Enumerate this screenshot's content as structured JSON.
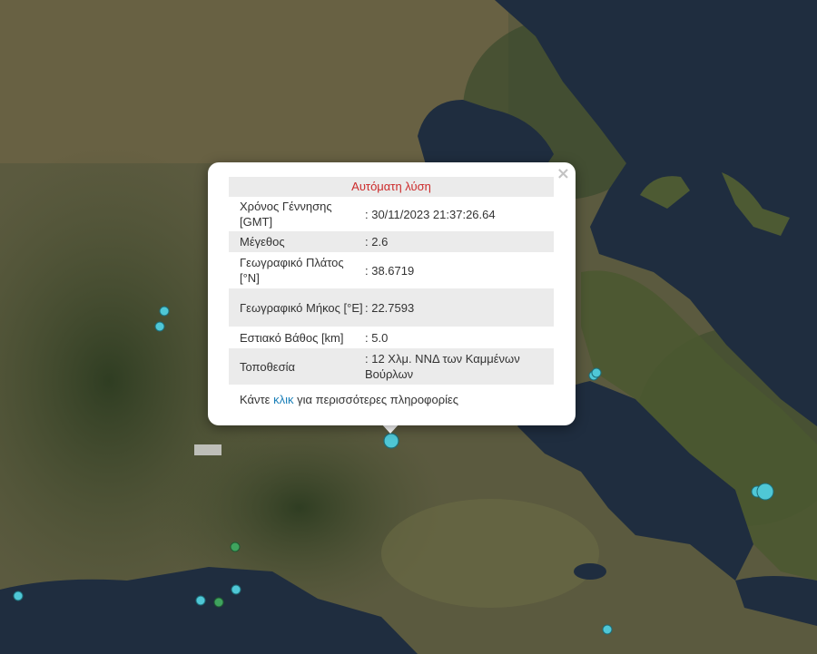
{
  "popup": {
    "title": "Αυτόματη λύση",
    "close": "×",
    "rows": [
      {
        "label": "Χρόνος Γέννησης [GMT]",
        "value": ": 30/11/2023 21:37:26.64"
      },
      {
        "label": "Μέγεθος",
        "value": ": 2.6"
      },
      {
        "label": "Γεωγραφικό Πλάτος [°N]",
        "value": ": 38.6719"
      },
      {
        "label": "Γεωγραφικό Μήκος [°E]",
        "value": ": 22.7593"
      },
      {
        "label": "Εστιακό Βάθος [km]",
        "value": ": 5.0"
      },
      {
        "label": "Τοποθεσία",
        "value": ": 12 Χλμ. ΝΝΔ των Καμμένων Βούρλων"
      }
    ],
    "more_before": "Κάντε ",
    "more_link": "κλικ",
    "more_after": " για περισσότερες πληροφορίες"
  },
  "map": {
    "marker_color_cyan": "#4fc7d6",
    "marker_color_green": "#3fa35e",
    "sea_color": "#1f2d3f",
    "land_color": "#5b5e3a"
  }
}
